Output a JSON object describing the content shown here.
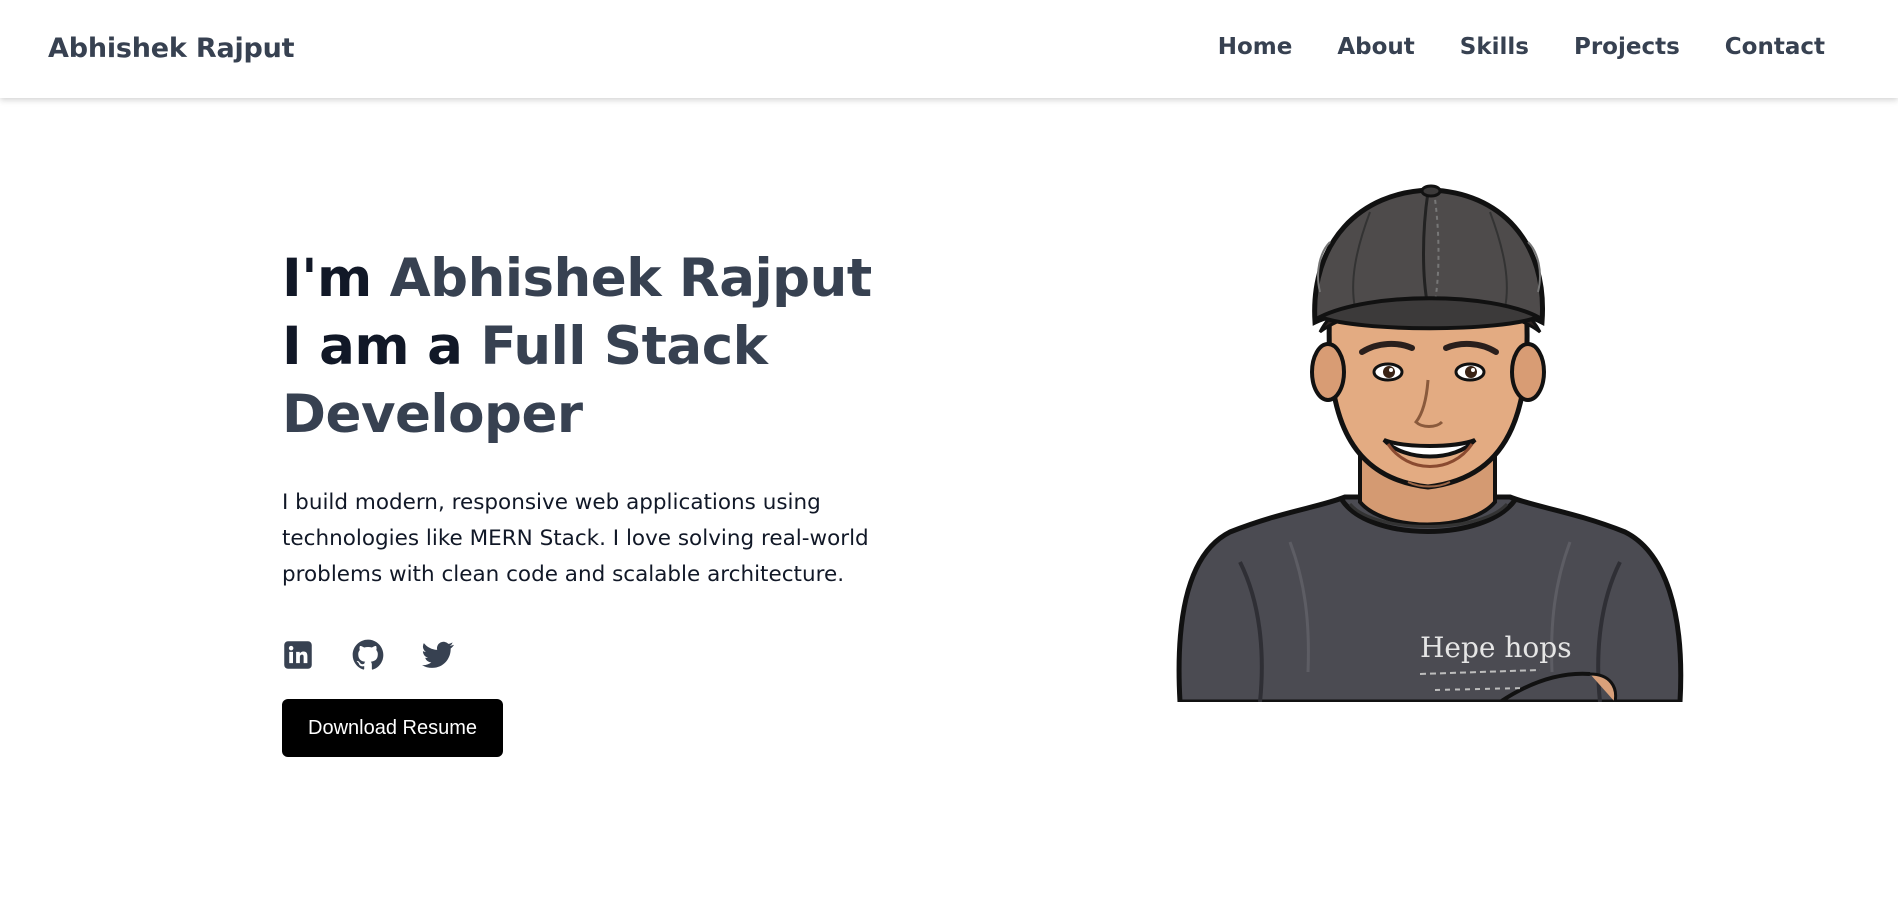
{
  "navbar": {
    "brand": "Abhishek Rajput",
    "links": [
      "Home",
      "About",
      "Skills",
      "Projects",
      "Contact"
    ]
  },
  "hero": {
    "line1_prefix": "I'm",
    "line1_name": "Abhishek Rajput",
    "line2_prefix": "I am a",
    "line2_role": "Full Stack Developer",
    "bio": "I build modern, responsive web applications using technologies like MERN Stack. I love solving real-world problems with clean code and scalable architecture.",
    "download_label": "Download Resume",
    "shirt_text": "Hepe hops"
  },
  "socials": [
    {
      "icon": "linkedin-icon"
    },
    {
      "icon": "github-icon"
    },
    {
      "icon": "twitter-icon"
    }
  ],
  "colors": {
    "heading_dark": "#111827",
    "heading_accent": "#374151",
    "button_bg": "#000000",
    "button_text": "#ffffff"
  }
}
